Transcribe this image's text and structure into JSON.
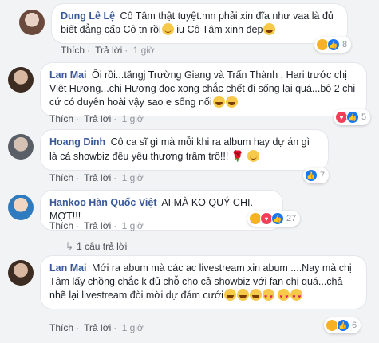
{
  "comments": [
    {
      "author": "Dung Lê Lệ",
      "text": "Cô Tâm thật tuyệt.mn phải xin đĩa như vaa là đủ biết đẳng cấp Cô tn rồi",
      "text_tail": " iu Cô Tâm xinh đẹp",
      "like_label": "Thích",
      "reply_label": "Trả lời",
      "time": "1 giờ",
      "reaction_count": "8",
      "avatar_color": "#b89c8c"
    },
    {
      "author": "Lan Mai",
      "text": "Ôi rồi...tăngj Trường Giang và Trấn Thành , Hari trước chị Việt Hương...chị Hương đọc xong chắc chết đi sống lại quá...bộ 2 chị cứ có duyên hoài vậy sao e sống nổi",
      "like_label": "Thích",
      "reply_label": "Trả lời",
      "time": "1 giờ",
      "reaction_count": "5",
      "avatar_color": "#7a6a5a"
    },
    {
      "author": "Hoang Dinh",
      "text": "Cô ca sĩ gì mà mỗi khi ra album hay dự án gì là cả showbiz đều yêu thương trầm trồ!!!",
      "like_label": "Thích",
      "reply_label": "Trả lời",
      "time": "1 giờ",
      "reaction_count": "7",
      "avatar_color": "#8a8f9a"
    },
    {
      "author": "Hankoo Hàn Quốc Việt",
      "text": "AI MÀ KO QUÝ CHỊ. MỢT!!!",
      "like_label": "Thích",
      "reply_label": "Trả lời",
      "time": "1 giờ",
      "reaction_count": "27",
      "avatar_color": "#2e7bbf",
      "replies_label": "1 câu trả lời"
    },
    {
      "author": "Lan Mai",
      "text": "Mới ra abum mà các ac livestream xin abum ....Nay mà chị Tâm lấy chồng chắc k đủ chỗ cho cả showbiz với fan chị quá...chả nhẽ lại livestream đòi mời dự đám cưới",
      "like_label": "Thích",
      "reply_label": "Trả lời",
      "time": "1 giờ",
      "reaction_count": "6",
      "avatar_color": "#7a6a5a"
    }
  ],
  "colors": {
    "author": "#385898",
    "like_blue": "#1877f2",
    "love_red": "#f33e58",
    "haha_yellow": "#f7b125",
    "meta_gray": "#90949c"
  },
  "icons": [
    "like-icon",
    "love-icon",
    "haha-icon",
    "heart-eyes-emoji",
    "laugh-emoji",
    "smile-emoji",
    "rose-emoji",
    "reply-arrow-icon"
  ]
}
